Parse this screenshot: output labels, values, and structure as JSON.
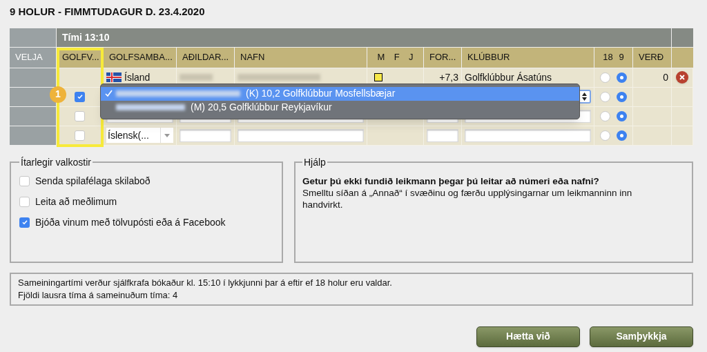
{
  "title": "9 HOLUR - FIMMTUDAGUR D. 23.4.2020",
  "table": {
    "group_header": "Tími 13:10",
    "columns": [
      {
        "label": "VELJA"
      },
      {
        "label": "GOLFV..."
      },
      {
        "label": "GOLFSAMBA..."
      },
      {
        "label": "AÐILDAR..."
      },
      {
        "label": "NAFN"
      },
      {
        "labels": [
          "M",
          "F",
          "J"
        ]
      },
      {
        "label": "FOR..."
      },
      {
        "label": "KLÚBBUR"
      },
      {
        "labels": [
          "18",
          "9"
        ]
      },
      {
        "label": "VERÐ"
      }
    ],
    "rows": [
      {
        "kind": "player",
        "country": "Ísland",
        "gender": [
          {
            "selected": true
          },
          {
            "selected": false
          },
          {
            "selected": false
          }
        ],
        "handicap": "+7,3",
        "club": "Golfklúbbur Ásatúns",
        "holes": [
          {
            "selected": false
          },
          {
            "selected": true
          }
        ],
        "price": "0"
      },
      {
        "kind": "picker",
        "checked": true,
        "holes": [
          {
            "selected": false
          },
          {
            "selected": true
          }
        ]
      },
      {
        "kind": "entry",
        "checked": false,
        "holes": [
          {
            "selected": false
          },
          {
            "selected": true
          }
        ]
      },
      {
        "kind": "entry",
        "checked": false,
        "country": "Íslensk(...",
        "holes": [
          {
            "selected": false
          },
          {
            "selected": true
          }
        ]
      }
    ]
  },
  "step_badge": "1",
  "dropdown": {
    "options": [
      {
        "text": "(K) 10,2 Golfklúbbur Mosfellsbæjar",
        "selected": true
      },
      {
        "text": "(M) 20,5 Golfklúbbur Reykjavíkur",
        "selected": false
      }
    ]
  },
  "options_panel": {
    "legend": "Ítarlegir valkostir",
    "items": [
      {
        "label": "Senda spilafélaga skilaboð",
        "checked": false
      },
      {
        "label": "Leita að meðlimum",
        "checked": false
      },
      {
        "label": "Bjóða vinum með tölvupósti eða á Facebook",
        "checked": true
      }
    ]
  },
  "help_panel": {
    "legend": "Hjálp",
    "text": "**Getur þú ekki fundið leikmann þegar þú leitar að númeri eða nafni?** Smelltu síðan á „Annað“ í svæðinu og færðu upplýsingarnar um leikmanninn inn handvirkt."
  },
  "info": [
    "Sameiningartími verður sjálfkrafa bókaður kl. 15:10 í lykkjunni þar á eftir ef 18 holur eru valdar.",
    "Fjöldi lausra tíma á sameinuðum tíma: 4"
  ],
  "buttons": [
    "Hætta við",
    "Samþykkja"
  ]
}
